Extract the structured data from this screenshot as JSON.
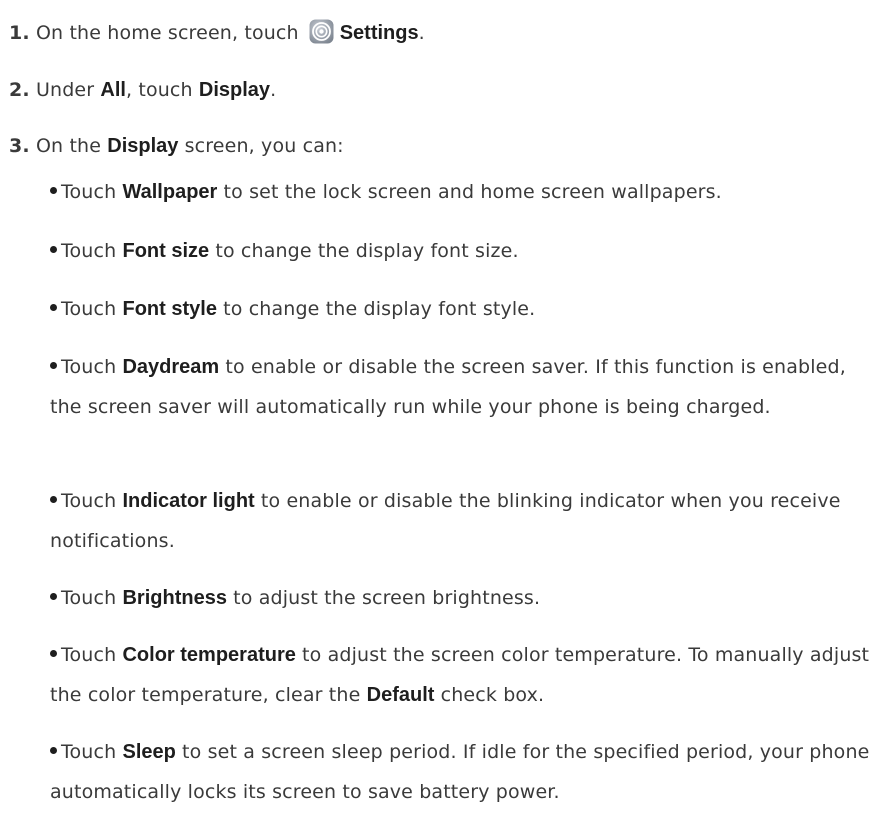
{
  "steps": [
    {
      "num": "1.",
      "pre": "On the home screen, touch",
      "bold": "Settings",
      "post": ".",
      "icon": "settings-gear-icon"
    },
    {
      "num": "2.",
      "pre": "Under ",
      "bold1": "All",
      "mid": ", touch ",
      "bold2": "Display",
      "post": "."
    },
    {
      "num": "3.",
      "pre": "On the ",
      "bold": "Display",
      "post": " screen, you can:"
    }
  ],
  "bullets": [
    {
      "pre": "Touch ",
      "bold": "Wallpaper",
      "post": " to set the lock screen and home screen wallpapers."
    },
    {
      "pre": "Touch ",
      "bold": "Font size",
      "post": " to change the display font size."
    },
    {
      "pre": "Touch ",
      "bold": "Font style",
      "post": " to change the display font style."
    },
    {
      "pre": "Touch ",
      "bold": "Daydream",
      "post": " to enable or disable the screen saver. If this function is enabled, the screen saver will automatically run while your phone is being charged."
    },
    {
      "pre": "Touch ",
      "bold": "Indicator light",
      "post": " to enable or disable the blinking indicator when you receive notifications."
    },
    {
      "pre": "Touch ",
      "bold": "Brightness",
      "post": " to adjust the screen brightness."
    },
    {
      "pre": "Touch ",
      "bold": "Color temperature",
      "post": " to adjust the screen color temperature. To manually adjust the color temperature, clear the ",
      "bold2": "Default",
      "post2": " check box."
    },
    {
      "pre": "Touch ",
      "bold": "Sleep",
      "post": " to set a screen sleep period. If idle for the specified period, your phone automatically locks its screen to save battery power."
    }
  ]
}
